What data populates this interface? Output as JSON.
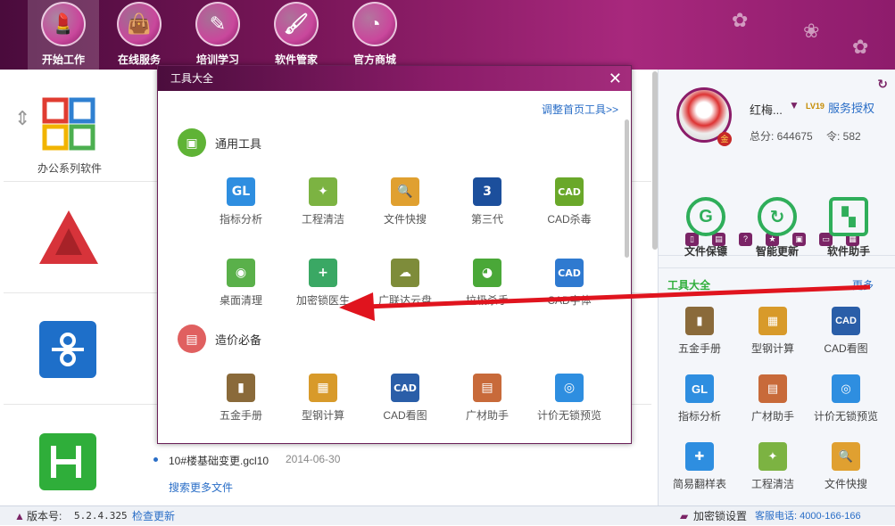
{
  "nav": [
    {
      "label": "开始工作",
      "icon": "lipstick-icon"
    },
    {
      "label": "在线服务",
      "icon": "bag-icon"
    },
    {
      "label": "培训学习",
      "icon": "pencil-icon"
    },
    {
      "label": "软件管家",
      "icon": "brush-icon"
    },
    {
      "label": "官方商城",
      "icon": "mirror-icon"
    }
  ],
  "left": {
    "office_label": "办公系列软件",
    "file_row": {
      "name": "10#楼基础变更.gcl10",
      "date": "2014-06-30"
    },
    "search_more": "搜索更多文件"
  },
  "dialog": {
    "title": "工具大全",
    "adjust_link": "调整首页工具>>",
    "sections": [
      {
        "label": "通用工具",
        "tools": [
          {
            "label": "指标分析",
            "icon": "chart-icon",
            "color": "#2e8ee0",
            "glyph": "GL"
          },
          {
            "label": "工程清洁",
            "icon": "broom-icon",
            "color": "#7cb342",
            "glyph": "✦"
          },
          {
            "label": "文件快搜",
            "icon": "file-search-icon",
            "color": "#e0a030",
            "glyph": "🔍"
          },
          {
            "label": "第三代",
            "icon": "number-three-icon",
            "color": "#1c4f9c",
            "glyph": "3"
          },
          {
            "label": "CAD杀毒",
            "icon": "cad-antivirus-icon",
            "color": "#6aa82a",
            "glyph": "CAD"
          },
          {
            "label": "桌面清理",
            "icon": "camera-icon",
            "color": "#5ab04a",
            "glyph": "◉"
          },
          {
            "label": "加密锁医生",
            "icon": "lock-doctor-icon",
            "color": "#3aa864",
            "glyph": "+"
          },
          {
            "label": "广联达云盘",
            "icon": "cloud-disk-icon",
            "color": "#7e8c3a",
            "glyph": "☁"
          },
          {
            "label": "垃圾杀手",
            "icon": "trash-killer-icon",
            "color": "#4aa838",
            "glyph": "◕"
          },
          {
            "label": "CAD字体",
            "icon": "cad-font-icon",
            "color": "#2f7ad0",
            "glyph": "CAD"
          }
        ]
      },
      {
        "label": "造价必备",
        "tools": [
          {
            "label": "五金手册",
            "icon": "handbook-icon",
            "color": "#8a6a3a",
            "glyph": "▮"
          },
          {
            "label": "型钢计算",
            "icon": "steel-calc-icon",
            "color": "#d89a2a",
            "glyph": "▦"
          },
          {
            "label": "CAD看图",
            "icon": "cad-view-icon",
            "color": "#2a5ea8",
            "glyph": "CAD"
          },
          {
            "label": "广材助手",
            "icon": "material-helper-icon",
            "color": "#c86a3a",
            "glyph": "▤"
          },
          {
            "label": "计价无锁预览",
            "icon": "eye-icon",
            "color": "#2e8ee0",
            "glyph": "◎"
          }
        ]
      }
    ]
  },
  "user": {
    "name": "红梅...",
    "badge": "LV19",
    "auth": "服务授权",
    "score_label": "总分: 644675",
    "token_label": "令: 582",
    "level_badge": "金"
  },
  "features": [
    {
      "label": "文件保镖",
      "icon": "shield-icon"
    },
    {
      "label": "智能更新",
      "icon": "update-icon"
    },
    {
      "label": "软件助手",
      "icon": "software-helper-icon"
    }
  ],
  "right_tools": {
    "title": "工具大全",
    "more": "更多",
    "items": [
      {
        "label": "五金手册",
        "icon": "handbook-icon",
        "color": "#8a6a3a",
        "glyph": "▮"
      },
      {
        "label": "型钢计算",
        "icon": "steel-calc-icon",
        "color": "#d89a2a",
        "glyph": "▦"
      },
      {
        "label": "CAD看图",
        "icon": "cad-view-icon",
        "color": "#2a5ea8",
        "glyph": "CAD"
      },
      {
        "label": "指标分析",
        "icon": "chart-icon",
        "color": "#2e8ee0",
        "glyph": "GL"
      },
      {
        "label": "广材助手",
        "icon": "material-helper-icon",
        "color": "#c86a3a",
        "glyph": "▤"
      },
      {
        "label": "计价无锁预览",
        "icon": "eye-icon",
        "color": "#2e8ee0",
        "glyph": "◎"
      },
      {
        "label": "简易翻样表",
        "icon": "rebar-table-icon",
        "color": "#2e8ee0",
        "glyph": "✚"
      },
      {
        "label": "工程清洁",
        "icon": "broom-icon",
        "color": "#7cb342",
        "glyph": "✦"
      },
      {
        "label": "文件快搜",
        "icon": "file-search-icon",
        "color": "#e0a030",
        "glyph": "🔍"
      }
    ]
  },
  "status": {
    "version_label": "版本号:",
    "version": "5.2.4.325",
    "check_update": "检查更新",
    "lock_setting": "加密锁设置",
    "hotline": "客服电话: 4000-166-166"
  }
}
